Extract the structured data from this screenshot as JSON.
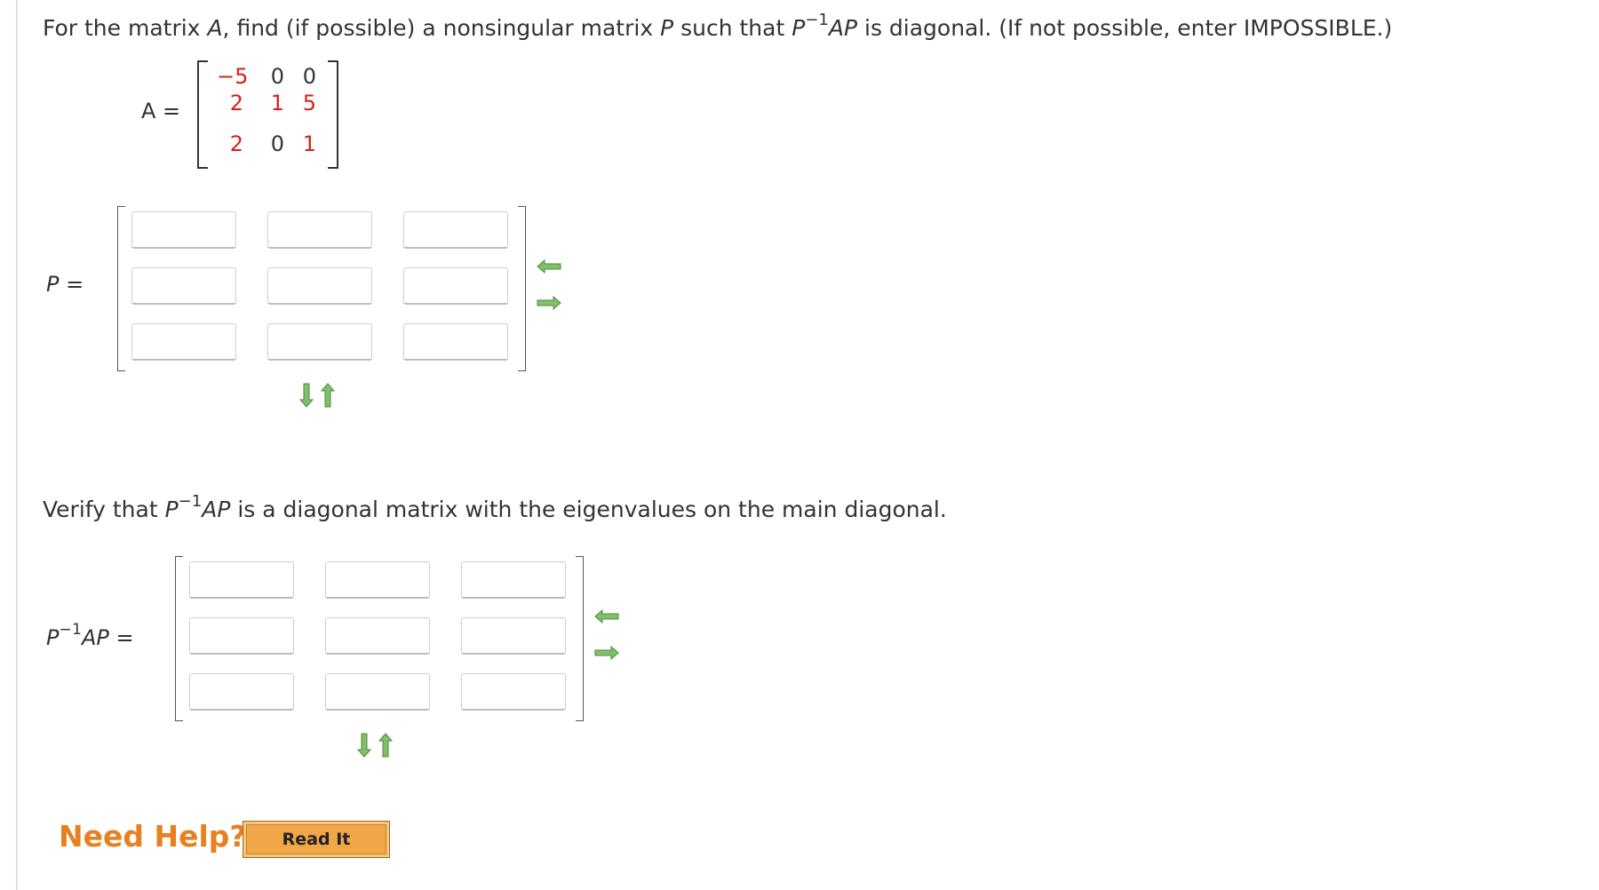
{
  "question": {
    "prefix": "For the matrix ",
    "var_a": "A",
    "mid1": ", find (if possible) a nonsingular matrix ",
    "var_p": "P",
    "mid2": " such that ",
    "p_base": "P",
    "p_exp": "−1",
    "ap": "AP",
    "suffix": " is diagonal. (If not possible, enter IMPOSSIBLE.)"
  },
  "matrix_a": {
    "label": "A =",
    "rows": [
      [
        "−5",
        "0",
        "0"
      ],
      [
        "2",
        "1",
        "5"
      ],
      [
        "2",
        "0",
        "1"
      ]
    ]
  },
  "matrix_p": {
    "label_var": "P",
    "label_eq": " ="
  },
  "verify": {
    "prefix": "Verify that ",
    "p_base": "P",
    "p_exp": "−1",
    "ap": "AP",
    "suffix": " is a diagonal matrix with the eigenvalues on the main diagonal."
  },
  "matrix_d": {
    "label_base": "P",
    "label_exp": "−1",
    "label_ap": "AP",
    "label_eq": " ="
  },
  "help": {
    "label": "Need Help?",
    "read_it": "Read It"
  },
  "colors": {
    "matrix_entries": "#d4221a",
    "help_text": "#e7801f",
    "arrow_green": "#5fa34a"
  }
}
